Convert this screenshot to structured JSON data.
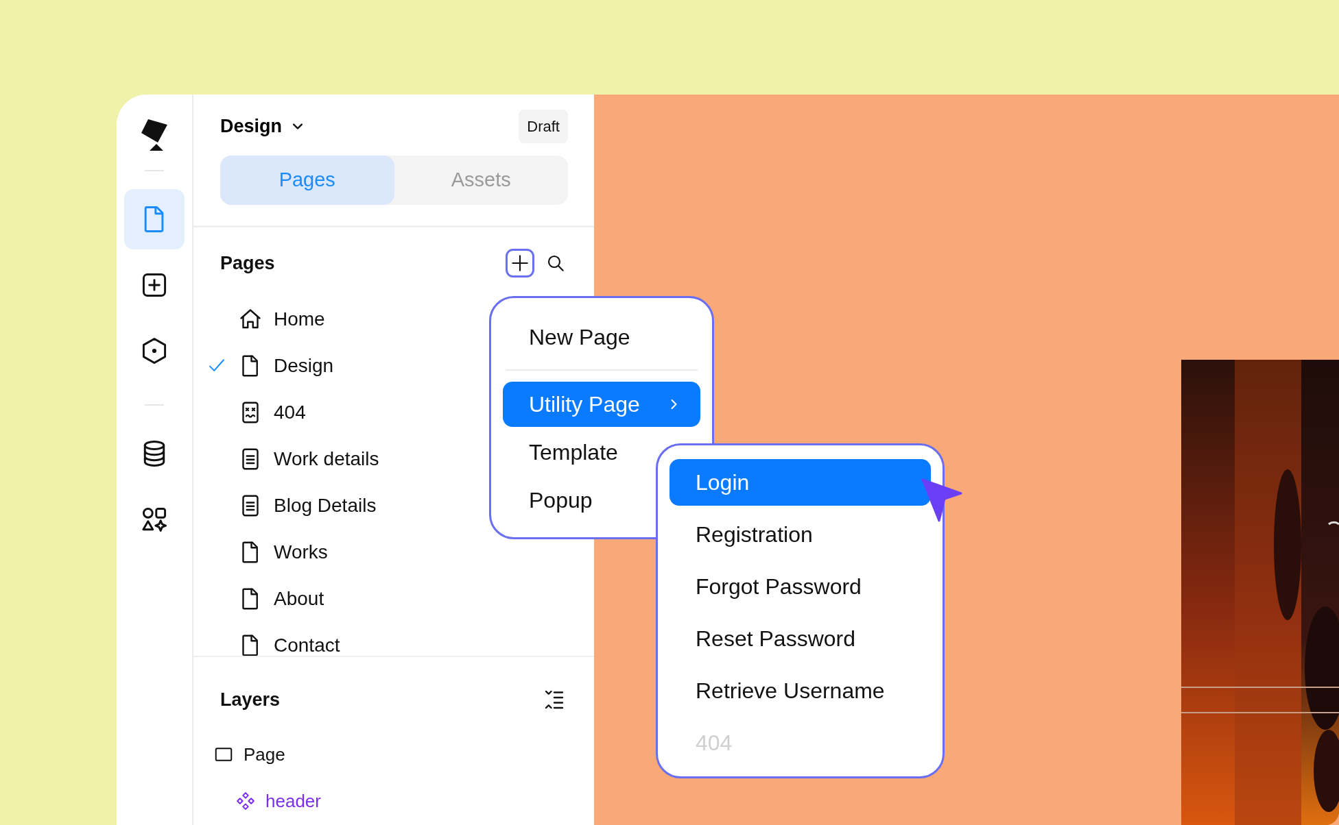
{
  "project": {
    "name": "Design",
    "status": "Draft"
  },
  "rail": [
    {
      "kind": "pages",
      "selected": true
    },
    {
      "kind": "add",
      "selected": false
    },
    {
      "kind": "component",
      "selected": false
    },
    {
      "kind": "data",
      "selected": false
    },
    {
      "kind": "assets",
      "selected": false
    }
  ],
  "tabs": [
    {
      "label": "Pages",
      "selected": true
    },
    {
      "label": "Assets",
      "selected": false
    }
  ],
  "pages": {
    "title": "Pages",
    "add_active": true,
    "items": [
      {
        "label": "Home",
        "kind": "home",
        "selected": false
      },
      {
        "label": "Design",
        "kind": "page",
        "selected": true
      },
      {
        "label": "404",
        "kind": "error",
        "selected": false
      },
      {
        "label": "Work details",
        "kind": "document",
        "selected": false
      },
      {
        "label": "Blog Details",
        "kind": "document",
        "selected": false
      },
      {
        "label": "Works",
        "kind": "page",
        "selected": false
      },
      {
        "label": "About",
        "kind": "page",
        "selected": false
      },
      {
        "label": "Contact",
        "kind": "page",
        "selected": false
      }
    ]
  },
  "add_menu": {
    "sections": [
      [
        {
          "label": "New Page",
          "selected": false,
          "kind": "action"
        }
      ],
      [
        {
          "label": "Utility Page",
          "selected": true,
          "kind": "submenu"
        },
        {
          "label": "Template",
          "selected": false,
          "kind": "action"
        },
        {
          "label": "Popup",
          "selected": false,
          "kind": "action"
        }
      ]
    ]
  },
  "utility_menu": {
    "items": [
      {
        "label": "Login",
        "selected": true,
        "disabled": false
      },
      {
        "label": "Registration",
        "selected": false,
        "disabled": false
      },
      {
        "label": "Forgot Password",
        "selected": false,
        "disabled": false
      },
      {
        "label": "Reset Password",
        "selected": false,
        "disabled": false
      },
      {
        "label": "Retrieve Username",
        "selected": false,
        "disabled": false
      },
      {
        "label": "404",
        "selected": false,
        "disabled": true
      }
    ]
  },
  "layers": {
    "title": "Layers",
    "items": [
      {
        "label": "Page",
        "kind": "frame",
        "children": [
          {
            "label": "header",
            "kind": "component"
          }
        ]
      }
    ]
  }
}
